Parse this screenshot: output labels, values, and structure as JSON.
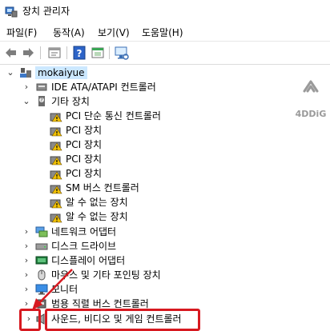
{
  "window": {
    "title": "장치 관리자",
    "icon": "device-manager-icon"
  },
  "menu": [
    {
      "label": "파일(F)"
    },
    {
      "label": "동작(A)"
    },
    {
      "label": "보기(V)"
    },
    {
      "label": "도움말(H)"
    }
  ],
  "toolbar": [
    "back-icon",
    "forward-icon",
    "properties-icon",
    "help-icon",
    "show-hidden-icon",
    "scan-hardware-icon"
  ],
  "tree": {
    "root": "mokaiyue",
    "items": [
      {
        "label": "IDE ATA/ATAPI 컨트롤러",
        "icon": "ide-controller-icon"
      },
      {
        "label": "기타 장치",
        "icon": "other-devices-icon",
        "expanded": true,
        "children": [
          {
            "label": "PCI 단순 통신 컨트롤러"
          },
          {
            "label": "PCI 장치"
          },
          {
            "label": "PCI 장치"
          },
          {
            "label": "PCI 장치"
          },
          {
            "label": "PCI 장치"
          },
          {
            "label": "SM 버스 컨트롤러"
          },
          {
            "label": "알 수 없는 장치"
          },
          {
            "label": "알 수 없는 장치"
          }
        ]
      },
      {
        "label": "네트워크 어댑터",
        "icon": "network-adapter-icon"
      },
      {
        "label": "디스크 드라이브",
        "icon": "disk-drive-icon"
      },
      {
        "label": "디스플레이 어댑터",
        "icon": "display-adapter-icon"
      },
      {
        "label": "마우스 및 기타 포인팅 장치",
        "icon": "mouse-icon"
      },
      {
        "label": "모니터",
        "icon": "monitor-icon"
      },
      {
        "label": "범용 직렬 버스 컨트롤러",
        "icon": "usb-controller-icon"
      },
      {
        "label": "사운드, 비디오 및 게임 컨트롤러",
        "icon": "speaker-icon"
      }
    ]
  },
  "watermark": {
    "text": "4DDiG"
  },
  "colors": {
    "highlight": "#d71920",
    "selection": "#cce8ff",
    "warning": "#f2c200"
  }
}
